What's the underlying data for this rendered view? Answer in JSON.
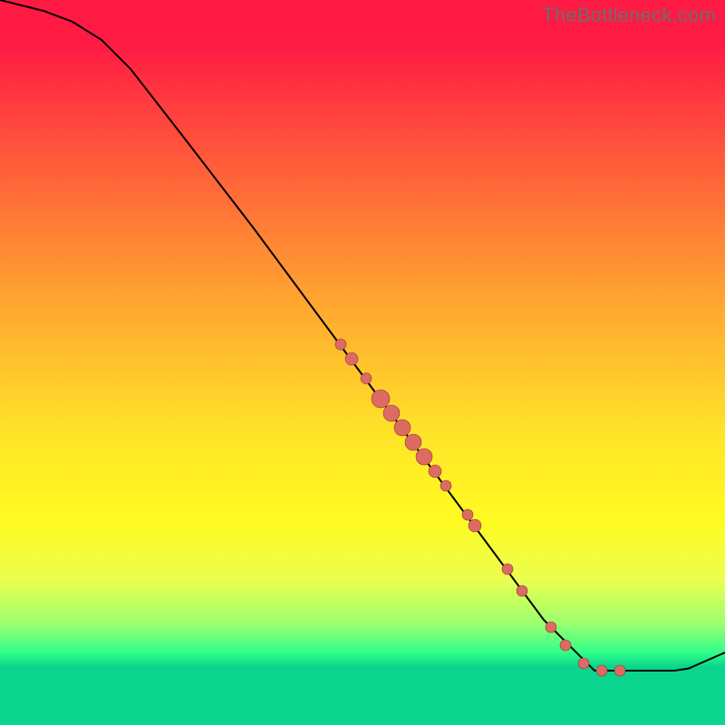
{
  "watermark": "TheBottleneck.com",
  "chart_data": {
    "type": "line",
    "title": "",
    "xlabel": "",
    "ylabel": "",
    "xlim": [
      0,
      100
    ],
    "ylim": [
      0,
      100
    ],
    "grid": false,
    "legend": false,
    "curve": [
      {
        "x": 0,
        "y": 100
      },
      {
        "x": 2,
        "y": 99.5
      },
      {
        "x": 6,
        "y": 98.5
      },
      {
        "x": 10,
        "y": 97.0
      },
      {
        "x": 14,
        "y": 94.5
      },
      {
        "x": 18,
        "y": 90.5
      },
      {
        "x": 25,
        "y": 81.5
      },
      {
        "x": 35,
        "y": 68.5
      },
      {
        "x": 45,
        "y": 55.0
      },
      {
        "x": 55,
        "y": 41.5
      },
      {
        "x": 65,
        "y": 28.0
      },
      {
        "x": 75,
        "y": 14.5
      },
      {
        "x": 82,
        "y": 7.5
      },
      {
        "x": 85,
        "y": 7.5
      },
      {
        "x": 90,
        "y": 7.5
      },
      {
        "x": 93,
        "y": 7.5
      },
      {
        "x": 95,
        "y": 7.8
      },
      {
        "x": 100,
        "y": 10.0
      }
    ],
    "scatter": [
      {
        "x": 47,
        "y": 52.5,
        "r": 6
      },
      {
        "x": 48.5,
        "y": 50.5,
        "r": 7
      },
      {
        "x": 50.5,
        "y": 47.8,
        "r": 6
      },
      {
        "x": 52.5,
        "y": 45.0,
        "r": 10
      },
      {
        "x": 54,
        "y": 43.0,
        "r": 9
      },
      {
        "x": 55.5,
        "y": 41.0,
        "r": 9
      },
      {
        "x": 57,
        "y": 39.0,
        "r": 9
      },
      {
        "x": 58.5,
        "y": 37.0,
        "r": 9
      },
      {
        "x": 60,
        "y": 35.0,
        "r": 7
      },
      {
        "x": 61.5,
        "y": 33.0,
        "r": 6
      },
      {
        "x": 64.5,
        "y": 29.0,
        "r": 6
      },
      {
        "x": 65.5,
        "y": 27.5,
        "r": 7
      },
      {
        "x": 70,
        "y": 21.5,
        "r": 6
      },
      {
        "x": 72,
        "y": 18.5,
        "r": 6
      },
      {
        "x": 76,
        "y": 13.5,
        "r": 6
      },
      {
        "x": 78,
        "y": 11.0,
        "r": 6
      },
      {
        "x": 80.5,
        "y": 8.5,
        "r": 6
      },
      {
        "x": 83,
        "y": 7.5,
        "r": 6
      },
      {
        "x": 85.5,
        "y": 7.5,
        "r": 6
      }
    ]
  }
}
